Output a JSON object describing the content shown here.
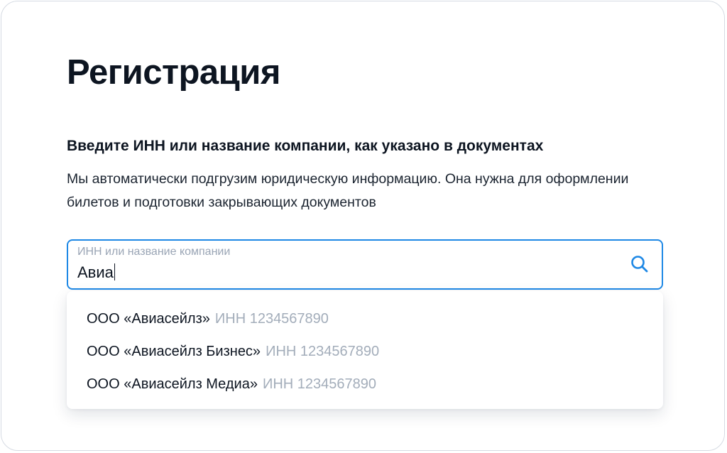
{
  "page": {
    "title": "Регистрация",
    "subtitle": "Введите ИНН или название компании, как указано в документах",
    "description": "Мы автоматически подгрузим юридическую информацию. Она нужна для оформлении билетов и подготовки закрывающих документов"
  },
  "search": {
    "label": "ИНН или название компании",
    "value": "Авиа",
    "icon": "search-icon",
    "accent_color": "#1e88e5"
  },
  "suggestions": [
    {
      "name": "ООО «Авиасейлз»",
      "inn": "ИНН 1234567890"
    },
    {
      "name": "ООО «Авиасейлз Бизнес»",
      "inn": "ИНН 1234567890"
    },
    {
      "name": "ООО «Авиасейлз Медиа»",
      "inn": "ИНН 1234567890"
    }
  ]
}
